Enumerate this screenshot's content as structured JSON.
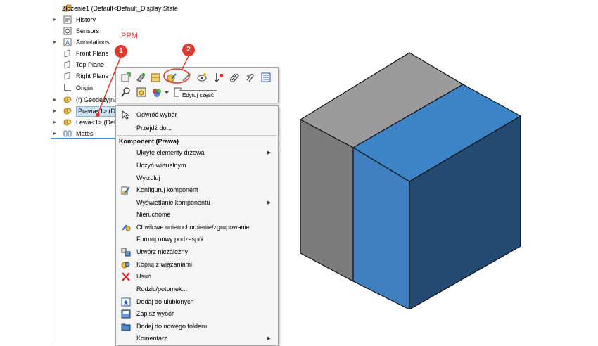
{
  "tree": {
    "items": [
      {
        "label": "Złozenie1  (Default<Default_Display State",
        "icon": "assembly-icon",
        "expander": ""
      },
      {
        "label": "History",
        "icon": "history-icon",
        "expander": "▸"
      },
      {
        "label": "Sensors",
        "icon": "sensors-icon",
        "expander": ""
      },
      {
        "label": "Annotations",
        "icon": "annotations-icon",
        "expander": "▸"
      },
      {
        "label": "Front Plane",
        "icon": "plane-icon",
        "expander": ""
      },
      {
        "label": "Top Plane",
        "icon": "plane-icon",
        "expander": ""
      },
      {
        "label": "Right Plane",
        "icon": "plane-icon",
        "expander": ""
      },
      {
        "label": "Origin",
        "icon": "origin-icon",
        "expander": ""
      },
      {
        "label": "(f) Geodezyjna",
        "icon": "part-icon",
        "expander": "▸"
      },
      {
        "label": "Prawa<1> (Def",
        "icon": "part-icon",
        "expander": "▸"
      },
      {
        "label": "Lewa<1> (Defa",
        "icon": "part-icon",
        "expander": "▸"
      },
      {
        "label": "Mates",
        "icon": "mates-icon",
        "expander": "▸"
      }
    ]
  },
  "annotation": {
    "ppm_label": "PPM",
    "badge1": "1",
    "badge2": "2",
    "color": "#e03a2e"
  },
  "toolbar": {
    "row1_icons": [
      "insert-component-icon",
      "smart-mates-icon",
      "mate-icon",
      "edit-part-icon",
      "rebuild-icon",
      "show-hide-icon",
      "move-component-icon",
      "hide-icon",
      "paperclip-icon",
      "appearance-icon",
      "properties-icon"
    ],
    "row2_icons": [
      "zoom-to-selection-icon",
      "open-part-icon",
      "color-icon",
      "dropdown-icon",
      "isolate-icon"
    ],
    "tooltip": "Edytuj część"
  },
  "context_menu": {
    "top_items": [
      {
        "label": "Odwróć wybór",
        "icon": "cursor-icon"
      },
      {
        "label": "Przejdź do...",
        "icon": ""
      }
    ],
    "section_header": "Komponent (Prawa)",
    "items": [
      {
        "label": "Ukryte elementy drzewa",
        "icon": "",
        "submenu": true
      },
      {
        "label": "Uczyń wirtualnym",
        "icon": "",
        "submenu": false
      },
      {
        "label": "Wyizoluj",
        "icon": "",
        "submenu": false
      },
      {
        "label": "Konfiguruj komponent",
        "icon": "configure-icon",
        "submenu": false
      },
      {
        "label": "Wyświetlanie komponentu",
        "icon": "",
        "submenu": true
      },
      {
        "label": "Nieruchome",
        "icon": "",
        "submenu": false
      },
      {
        "label": "Chwilowe unieruchomienie/zgrupowanie",
        "icon": "fix-group-icon",
        "submenu": false
      },
      {
        "label": "Formuj nowy podzespół",
        "icon": "",
        "submenu": false
      },
      {
        "label": "Utwórz niezależny",
        "icon": "make-independent-icon",
        "submenu": false
      },
      {
        "label": "Kopiuj z wiązaniami",
        "icon": "copy-mates-icon",
        "submenu": false
      },
      {
        "label": "Usuń",
        "icon": "delete-icon",
        "submenu": false
      },
      {
        "label": "Rodzic/potomek...",
        "icon": "",
        "submenu": false
      },
      {
        "label": "Dodaj do ulubionych",
        "icon": "favorites-icon",
        "submenu": false
      },
      {
        "label": "Zapisz wybór",
        "icon": "save-selection-icon",
        "submenu": false
      },
      {
        "label": "Dodaj do nowego folderu",
        "icon": "folder-icon",
        "submenu": false
      },
      {
        "label": "Komentarz",
        "icon": "",
        "submenu": true
      }
    ],
    "submenu_arrow": "▶"
  },
  "viewport": {
    "model_colors": {
      "gray_top": "#9b9b9b",
      "gray_left": "#7b7b7b",
      "blue_top": "#3d84c6",
      "blue_front": "#3e80c0",
      "blue_right": "#234a72",
      "edge": "#111111"
    }
  }
}
